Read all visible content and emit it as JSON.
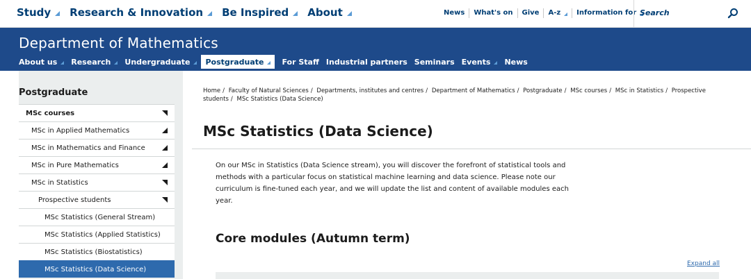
{
  "topnav": {
    "items": [
      {
        "label": "Study",
        "dropdown": true
      },
      {
        "label": "Research & Innovation",
        "dropdown": true
      },
      {
        "label": "Be Inspired",
        "dropdown": true
      },
      {
        "label": "About",
        "dropdown": true
      }
    ]
  },
  "utility": {
    "items": [
      {
        "label": "News",
        "dropdown": false
      },
      {
        "label": "What's on",
        "dropdown": false
      },
      {
        "label": "Give",
        "dropdown": false
      },
      {
        "label": "A-z",
        "dropdown": true
      },
      {
        "label": "Information for",
        "dropdown": true
      }
    ]
  },
  "search": {
    "placeholder": "Search",
    "icon": "search-icon"
  },
  "department": {
    "title": "Department of Mathematics",
    "nav": [
      {
        "label": "About us",
        "dropdown": true
      },
      {
        "label": "Research",
        "dropdown": true
      },
      {
        "label": "Undergraduate",
        "dropdown": true
      },
      {
        "label": "Postgraduate",
        "dropdown": true,
        "active": true
      },
      {
        "label": "For Staff",
        "dropdown": false
      },
      {
        "label": "Industrial partners",
        "dropdown": false
      },
      {
        "label": "Seminars",
        "dropdown": false
      },
      {
        "label": "Events",
        "dropdown": true
      },
      {
        "label": "News",
        "dropdown": false
      }
    ]
  },
  "sidebar": {
    "title": "Postgraduate",
    "items": [
      {
        "label": "MSc courses",
        "level": 0,
        "state": "expanded"
      },
      {
        "label": "MSc in Applied Mathematics",
        "level": 1,
        "state": "collapsed"
      },
      {
        "label": "MSc in Mathematics and Finance",
        "level": 1,
        "state": "collapsed"
      },
      {
        "label": "MSc in Pure Mathematics",
        "level": 1,
        "state": "collapsed"
      },
      {
        "label": "MSc in Statistics",
        "level": 1,
        "state": "expanded"
      },
      {
        "label": "Prospective students",
        "level": 2,
        "state": "expanded"
      },
      {
        "label": "MSc Statistics (General Stream)",
        "level": 3,
        "state": "none"
      },
      {
        "label": "MSc Statistics (Applied Statistics)",
        "level": 3,
        "state": "none"
      },
      {
        "label": "MSc Statistics (Biostatistics)",
        "level": 3,
        "state": "none"
      },
      {
        "label": "MSc Statistics (Data Science)",
        "level": 3,
        "state": "none",
        "active": true
      }
    ]
  },
  "breadcrumb": [
    "Home",
    "Faculty of Natural Sciences",
    "Departments, institutes and centres",
    "Department of Mathematics",
    "Postgraduate",
    "MSc courses",
    "MSc in Statistics",
    "Prospective students",
    "MSc Statistics (Data Science)"
  ],
  "page": {
    "title": "MSc Statistics (Data Science)",
    "intro": "On our MSc in Statistics (Data Science stream), you will discover the forefront of statistical tools and methods with a particular focus on statistical machine learning and data science. Please note our curriculum is fine-tuned each year, and we will update the list and content of available modules each year.",
    "section_heading": "Core modules (Autumn term)",
    "expand_all": "Expand all"
  },
  "colors": {
    "brand_navy": "#1e4a8a",
    "link_blue": "#003e74",
    "active_blue": "#2e6aad",
    "sidebar_bg": "#ebeeee"
  }
}
